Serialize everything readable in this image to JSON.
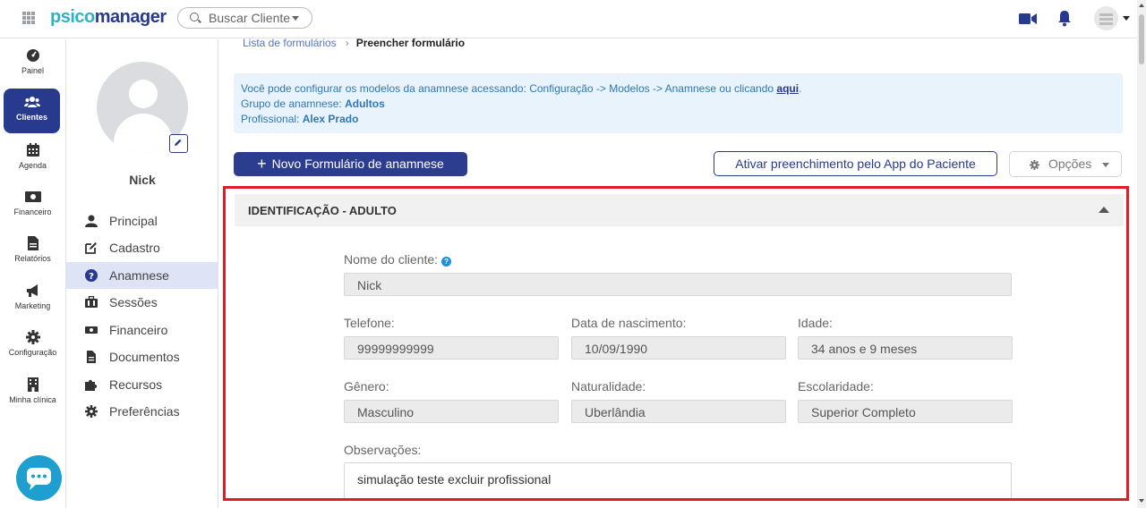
{
  "app": {
    "logo_part1": "psico",
    "logo_part2": "manager"
  },
  "header": {
    "search_label": "Buscar Cliente"
  },
  "nav": {
    "items": [
      {
        "label": "Painel",
        "icon": "dashboard-icon"
      },
      {
        "label": "Clientes",
        "icon": "users-icon"
      },
      {
        "label": "Agenda",
        "icon": "calendar-icon"
      },
      {
        "label": "Financeiro",
        "icon": "money-icon"
      },
      {
        "label": "Relatórios",
        "icon": "report-icon"
      },
      {
        "label": "Marketing",
        "icon": "megaphone-icon"
      },
      {
        "label": "Configuração",
        "icon": "gear-icon"
      },
      {
        "label": "Minha clínica",
        "icon": "building-icon"
      }
    ],
    "active": "Clientes",
    "accent_color": "#283a8e"
  },
  "client": {
    "name": "Nick",
    "menu": [
      {
        "label": "Principal",
        "icon": "user-icon"
      },
      {
        "label": "Cadastro",
        "icon": "edit-icon"
      },
      {
        "label": "Anamnese",
        "icon": "question-icon"
      },
      {
        "label": "Sessões",
        "icon": "briefcase-icon"
      },
      {
        "label": "Financeiro",
        "icon": "money-icon"
      },
      {
        "label": "Documentos",
        "icon": "file-icon"
      },
      {
        "label": "Recursos",
        "icon": "puzzle-icon"
      },
      {
        "label": "Preferências",
        "icon": "gear-icon"
      }
    ],
    "active_menu": "Anamnese"
  },
  "breadcrumb": {
    "item1": "Lista de formulários",
    "item2": "Preencher formulário"
  },
  "info": {
    "line1": "Você pode configurar os modelos da anamnese acessando: Configuração -> Modelos -> Anamnese ou clicando",
    "line1_link": "aqui",
    "line1_end": ".",
    "group_label": "Grupo de anamnese:",
    "group_value": "Adultos",
    "prof_label": "Profissional:",
    "prof_value": "Alex Prado"
  },
  "actions": {
    "new_form": "Novo Formulário de anamnese",
    "enable_app": "Ativar preenchimento pelo App do Paciente",
    "options": "Opções"
  },
  "section": {
    "title": "IDENTIFICAÇÃO - ADULTO",
    "fields": {
      "nome": {
        "label": "Nome do cliente:",
        "value": "Nick"
      },
      "telefone": {
        "label": "Telefone:",
        "value": "99999999999"
      },
      "nascimento": {
        "label": "Data de nascimento:",
        "value": "10/09/1990"
      },
      "idade": {
        "label": "Idade:",
        "value": "34 anos e 9 meses"
      },
      "genero": {
        "label": "Gênero:",
        "value": "Masculino"
      },
      "naturalidade": {
        "label": "Naturalidade:",
        "value": "Uberlândia"
      },
      "escolaridade": {
        "label": "Escolaridade:",
        "value": "Superior Completo"
      },
      "observacoes": {
        "label": "Observações:",
        "value": "simulação teste excluir profissional"
      }
    }
  }
}
